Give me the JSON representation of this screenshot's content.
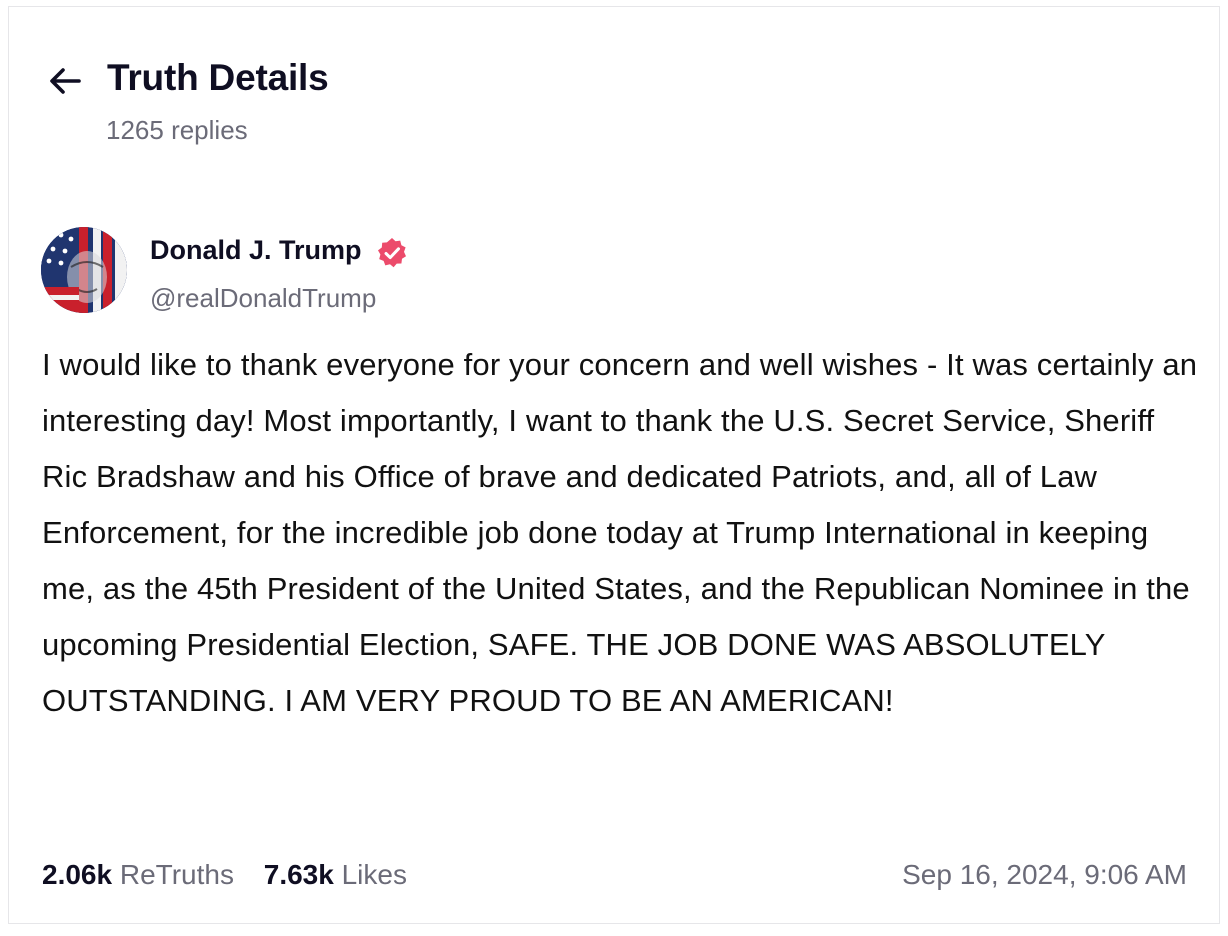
{
  "header": {
    "title": "Truth Details",
    "reply_count": "1265 replies",
    "back_icon": "arrow-left-icon"
  },
  "post": {
    "author": {
      "name": "Donald J. Trump",
      "handle": "@realDonaldTrump",
      "verified_icon": "verified-badge-icon",
      "verified_color": "#ec4b6b"
    },
    "body": "I would like to thank everyone for your concern and well wishes - It was certainly an interesting day! Most importantly, I want to thank the U.S. Secret Service, Sheriff Ric Bradshaw and his Office of brave and dedicated Patriots, and, all of Law Enforcement, for the incredible job done today at Trump International in keeping me, as the 45th President of the United States, and the Republican Nominee in the upcoming Presidential Election, SAFE. THE JOB DONE WAS ABSOLUTELY OUTSTANDING. I AM VERY PROUD TO BE AN AMERICAN!",
    "stats": {
      "retruths_value": "2.06k",
      "retruths_label": "ReTruths",
      "likes_value": "7.63k",
      "likes_label": "Likes"
    },
    "timestamp": "Sep 16, 2024, 9:06 AM"
  },
  "colors": {
    "text_primary": "#0f0e22",
    "text_secondary": "#6b6b78",
    "accent": "#ec4b6b"
  }
}
